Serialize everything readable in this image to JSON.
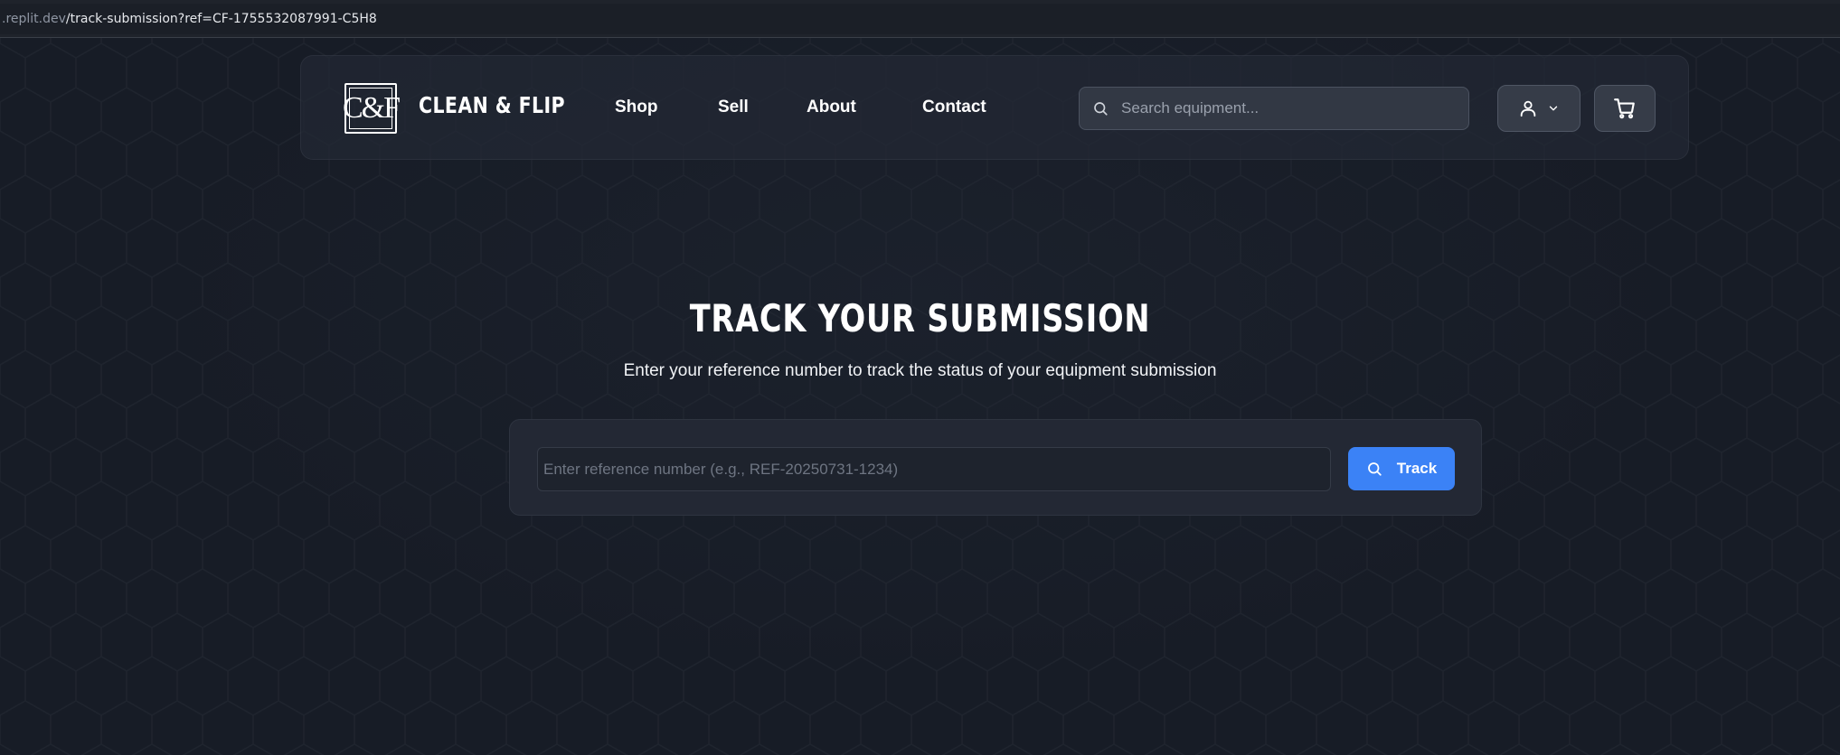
{
  "browser": {
    "url_host": ".replit.dev",
    "url_path": "/track-submission?ref=CF-1755532087991-C5H8"
  },
  "header": {
    "logo_text": "C&F",
    "brand_name": "CLEAN & FLIP",
    "nav": [
      {
        "label": "Shop"
      },
      {
        "label": "Sell"
      },
      {
        "label": "About"
      },
      {
        "label": "Contact"
      }
    ],
    "search": {
      "placeholder": "Search equipment...",
      "value": ""
    },
    "icons": {
      "user": "user-icon",
      "chevron": "chevron-down-icon",
      "cart": "cart-icon",
      "search": "search-icon"
    }
  },
  "main": {
    "title": "TRACK YOUR SUBMISSION",
    "subtitle": "Enter your reference number to track the status of your equipment submission",
    "reference_input": {
      "placeholder": "Enter reference number (e.g., REF-20250731-1234)",
      "value": ""
    },
    "track_button_label": "Track"
  },
  "colors": {
    "background": "#171c26",
    "header_bg": "#222834",
    "accent": "#3b82f6",
    "text": "#ffffff"
  }
}
